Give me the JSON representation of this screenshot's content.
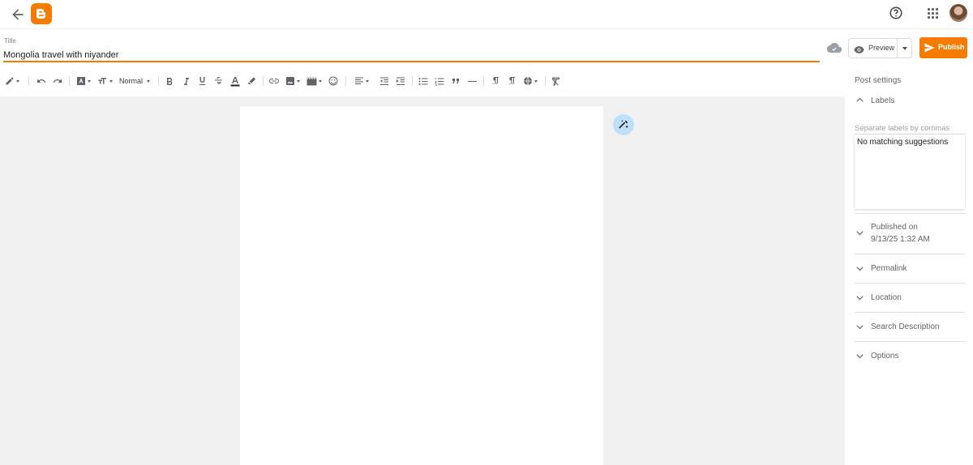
{
  "header": {
    "back_icon": "arrow-left-icon",
    "logo_icon": "blogger-logo-icon",
    "brand_color": "#f57c00",
    "help_icon": "help-circle-icon",
    "apps_icon": "apps-grid-icon",
    "avatar_icon": "user-avatar"
  },
  "post": {
    "title_label": "Title",
    "title_value": "Mongolia travel with niyander"
  },
  "actions": {
    "save_status_icon": "cloud-saved-icon",
    "preview_label": "Preview",
    "publish_label": "Publish"
  },
  "toolbar": {
    "paragraph_style": "Normal",
    "icons": [
      "edit-mode-icon",
      "undo-icon",
      "redo-icon",
      "font-family-icon",
      "font-size-icon",
      "bold-icon",
      "italic-icon",
      "underline-icon",
      "strikethrough-icon",
      "text-color-icon",
      "highlight-icon",
      "link-icon",
      "image-icon",
      "video-icon",
      "emoji-icon",
      "align-icon",
      "indent-decrease-icon",
      "indent-increase-icon",
      "bulleted-list-icon",
      "numbered-list-icon",
      "quote-icon",
      "horizontal-rule-icon",
      "ltr-icon",
      "rtl-icon",
      "language-icon",
      "clear-format-icon"
    ]
  },
  "sidebar": {
    "title": "Post settings",
    "labels_section": "Labels",
    "labels_placeholder": "Separate labels by commas",
    "labels_suggestion": "No matching suggestions",
    "published_label": "Published on",
    "published_date": "9/13/25 1:32 AM",
    "permalink": "Permalink",
    "location": "Location",
    "search_description": "Search Description",
    "options": "Options"
  }
}
